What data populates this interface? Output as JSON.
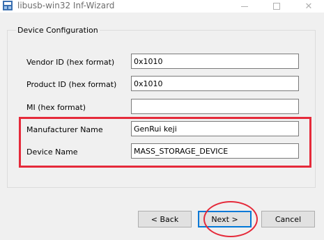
{
  "window": {
    "title": "libusb-win32 Inf-Wizard",
    "app_icon": "usb-wizard-icon",
    "controls": {
      "minimize": "minimize-icon",
      "maximize": "maximize-icon",
      "close": "close-icon"
    }
  },
  "group": {
    "title": "Device Configuration"
  },
  "fields": [
    {
      "label": "Vendor ID (hex format)",
      "value": "0x1010"
    },
    {
      "label": "Product ID (hex format)",
      "value": "0x1010"
    },
    {
      "label": "MI (hex format)",
      "value": ""
    },
    {
      "label": "Manufacturer Name",
      "value": "GenRui keji"
    },
    {
      "label": "Device Name",
      "value": "MASS_STORAGE_DEVICE"
    }
  ],
  "buttons": {
    "back": "< Back",
    "next": "Next >",
    "cancel": "Cancel"
  },
  "annotations": {
    "highlight_color": "#e52a3a"
  }
}
